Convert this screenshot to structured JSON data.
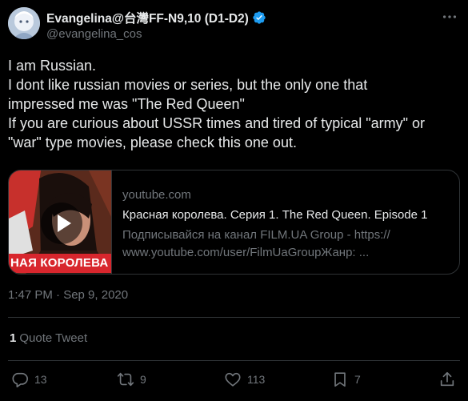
{
  "author": {
    "display_name": "Evangelina@台灣FF-N9,10 (D1-D2)",
    "handle": "@evangelina_cos"
  },
  "tweet": {
    "lines": [
      "I am Russian.",
      "I dont like russian movies or series, but the only one that",
      "impressed me was \"The Red Queen\"",
      "If you are curious about USSR times and tired of typical \"army\" or",
      "\"war\" type movies, please check this one out."
    ],
    "timestamp": "1:47 PM · Sep 9, 2020"
  },
  "card": {
    "thumbnail_text": "НАЯ КОРОЛЕВА",
    "domain": "youtube.com",
    "title": "Красная королева. Серия 1. The Red Queen. Episode 1",
    "description_lines": [
      "Подписывайся на канал FILM.UA Group - https://",
      "www.youtube.com/user/FilmUaGroupЖанр: ..."
    ]
  },
  "quote": {
    "count": "1",
    "label": "Quote Tweet"
  },
  "actions": {
    "replies": "13",
    "retweets": "9",
    "likes": "113",
    "bookmarks": "7"
  },
  "colors": {
    "background": "#000000",
    "text": "#e7e9ea",
    "secondary": "#71767b",
    "verified": "#1d9bf0",
    "border": "#2f3336",
    "banner_red": "#d8262d"
  },
  "icons": [
    "verified-badge-icon",
    "more-icon",
    "play-icon",
    "reply-icon",
    "retweet-icon",
    "like-icon",
    "bookmark-icon",
    "share-icon"
  ]
}
